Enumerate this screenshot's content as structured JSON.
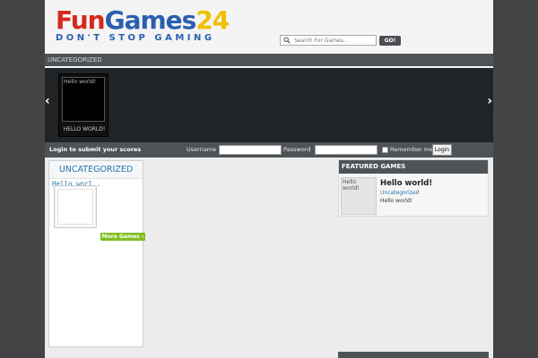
{
  "header": {
    "logo_part1": "Fun",
    "logo_part2": "Games",
    "logo_part3": "24",
    "tagline": "DON'T STOP GAMING",
    "search_placeholder": "Search For Games...",
    "go_label": "GO!"
  },
  "category_bar": {
    "label": "UNCATEGORIZED"
  },
  "slider": {
    "prev_glyph": "‹",
    "next_glyph": "›",
    "slide": {
      "thumb_text": "Hello world!",
      "caption": "HELLO WORLD!"
    }
  },
  "login": {
    "title": "Login to submit your scores",
    "username_label": "Username",
    "password_label": "Password",
    "remember_label": "Remember me",
    "button_label": "Login"
  },
  "category_box": {
    "title": "UNCATEGORIZED",
    "game_title": "Hello worl..",
    "more_label": "More Games"
  },
  "featured": {
    "heading": "FEATURED GAMES",
    "thumb_text": "Hello world!",
    "title": "Hello world!",
    "category": "Uncategorized",
    "description": "Hello world!"
  },
  "colors": {
    "background": "#444444",
    "bar": "#4e5358",
    "accent_blue": "#2a76a8",
    "more_button": "#7fbf1f"
  }
}
